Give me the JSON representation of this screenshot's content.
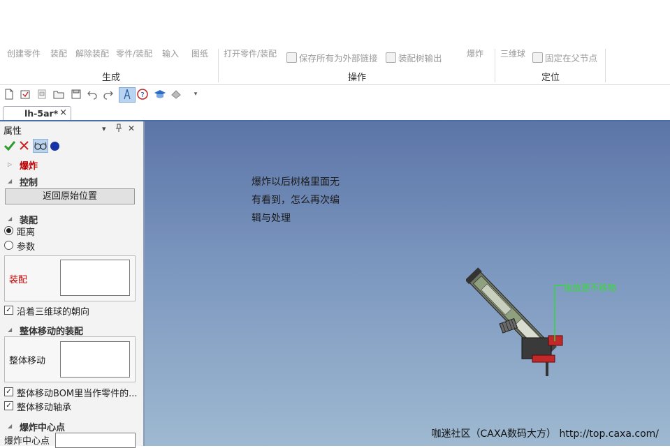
{
  "ribbon": {
    "partial_items": [
      "创建零件",
      "装配",
      "解除装配",
      "零件/装配",
      "输入",
      "图纸"
    ],
    "partial_open": "打开零件/装配",
    "save_external": "保存所有为外部链接",
    "assembly_tree_output": "装配树输出",
    "explode": "爆炸",
    "triball": "三维球",
    "fix_parent": "固定在父节点",
    "groups": {
      "generate": "生成",
      "operation": "操作",
      "position": "定位"
    }
  },
  "tab": {
    "title": "lh-5ar*",
    "close": "×"
  },
  "panel": {
    "title": "属性",
    "header_icons": {
      "dropdown": "▾",
      "pin": "ᛝ",
      "close": "✕"
    },
    "section_explode": "爆炸",
    "section_control": "控制",
    "btn_restore": "返回原始位置",
    "section_assembly": "装配",
    "radio_distance": "距离",
    "radio_param": "参数",
    "assembly_label": "装配",
    "chk_triball": "沿着三维球的朝向",
    "section_whole": "整体移动的装配",
    "whole_label": "整体移动",
    "chk_bom": "整体移动BOM里当作零件的...",
    "chk_bearing": "整体移动轴承",
    "section_center": "爆炸中心点",
    "center_label": "爆炸中心点"
  },
  "viewport": {
    "note": "爆炸以后树格里面无有看到，怎么再次编辑与处理",
    "note_line1": "爆炸以后树格里面无",
    "note_line2": "有看到，怎么再次编",
    "note_line3": "辑与处理",
    "footer": "咖迷社区（CAXA数码大方） http://top.caxa.com/",
    "model_label": "拖放更不移物"
  },
  "colors": {
    "accent": "#4a6fa6",
    "check_green": "#2e9b2e",
    "cancel_red": "#cc2222",
    "section_red": "#c00000",
    "viewport_top": "#5c75a8",
    "viewport_bottom": "#9eb9d0",
    "label_green": "#39d93a"
  }
}
